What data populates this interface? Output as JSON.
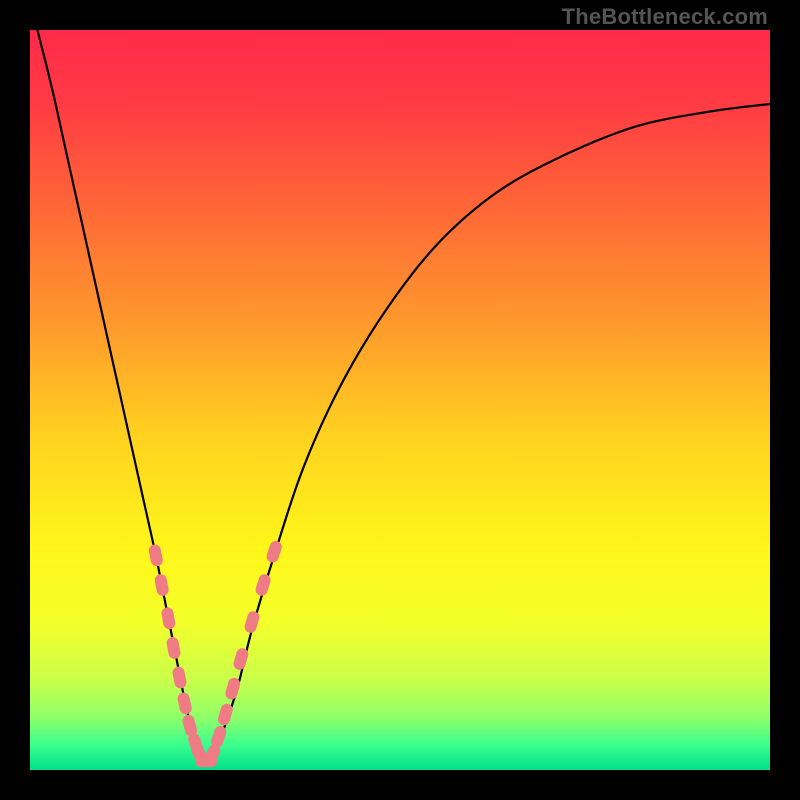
{
  "watermark": "TheBottleneck.com",
  "colors": {
    "black": "#000000",
    "curve_stroke": "#000000",
    "marker_fill": "#ef7b84",
    "marker_stroke": "#e86a74"
  },
  "gradient_stops": [
    {
      "offset": 0.0,
      "color": "#ff2a49"
    },
    {
      "offset": 0.1,
      "color": "#ff3b44"
    },
    {
      "offset": 0.25,
      "color": "#ff6a36"
    },
    {
      "offset": 0.4,
      "color": "#ff9a2c"
    },
    {
      "offset": 0.55,
      "color": "#ffd21f"
    },
    {
      "offset": 0.7,
      "color": "#fff61a"
    },
    {
      "offset": 0.8,
      "color": "#f4ff2a"
    },
    {
      "offset": 0.88,
      "color": "#c8ff4a"
    },
    {
      "offset": 0.93,
      "color": "#8dff6a"
    },
    {
      "offset": 0.965,
      "color": "#3cff8c"
    },
    {
      "offset": 1.0,
      "color": "#00e08a"
    }
  ],
  "chart_data": {
    "type": "line",
    "title": "",
    "xlabel": "",
    "ylabel": "",
    "xlim": [
      0,
      100
    ],
    "ylim": [
      0,
      100
    ],
    "note": "Bottleneck-style V curve; y is visual height (0 at bottom). Minimum near x≈23.",
    "series": [
      {
        "name": "curve",
        "x": [
          1,
          3,
          5,
          7,
          9,
          11,
          13,
          15,
          17,
          18,
          19,
          20,
          21,
          22,
          23,
          24,
          25,
          26,
          28,
          30,
          33,
          37,
          42,
          48,
          55,
          63,
          72,
          82,
          92,
          100
        ],
        "y": [
          100,
          92,
          83,
          74,
          65,
          56,
          47,
          38,
          29,
          24,
          19,
          14,
          9,
          5,
          2,
          1,
          2,
          5,
          11,
          19,
          29,
          41,
          52,
          62,
          71,
          78,
          83,
          87,
          89,
          90
        ]
      }
    ],
    "markers": [
      {
        "x": 17.0,
        "y": 29.0
      },
      {
        "x": 17.8,
        "y": 25.0
      },
      {
        "x": 18.7,
        "y": 20.5
      },
      {
        "x": 19.4,
        "y": 16.5
      },
      {
        "x": 20.2,
        "y": 12.5
      },
      {
        "x": 20.9,
        "y": 9.0
      },
      {
        "x": 21.6,
        "y": 6.0
      },
      {
        "x": 22.4,
        "y": 3.5
      },
      {
        "x": 23.0,
        "y": 2.0
      },
      {
        "x": 23.8,
        "y": 1.2
      },
      {
        "x": 24.6,
        "y": 2.0
      },
      {
        "x": 25.5,
        "y": 4.5
      },
      {
        "x": 26.4,
        "y": 7.5
      },
      {
        "x": 27.4,
        "y": 11.0
      },
      {
        "x": 28.5,
        "y": 15.0
      },
      {
        "x": 30.0,
        "y": 20.0
      },
      {
        "x": 31.5,
        "y": 25.0
      },
      {
        "x": 33.0,
        "y": 29.5
      }
    ]
  }
}
